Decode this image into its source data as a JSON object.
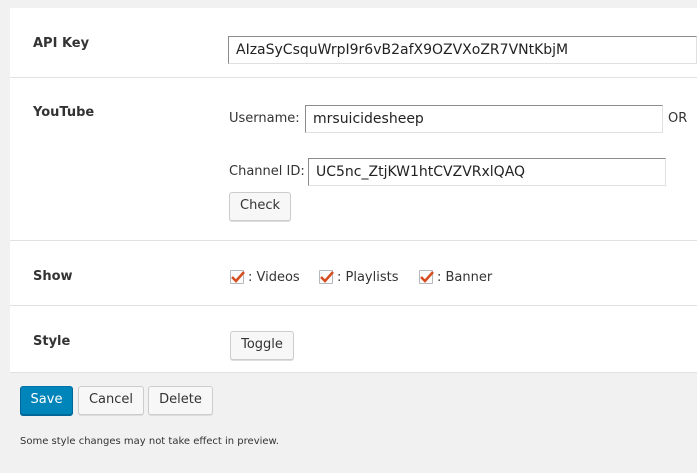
{
  "api_key": {
    "label": "API Key",
    "value": "AIzaSyCsquWrpI9r6vB2afX9OZVXoZR7VNtKbjM"
  },
  "youtube": {
    "label": "YouTube",
    "username_label": "Username:",
    "username_value": "mrsuicidesheep",
    "or_text": "OR",
    "channel_label": "Channel ID:",
    "channel_value": "UC5nc_ZtjKW1htCVZVRxlQAQ",
    "check_label": "Check"
  },
  "show": {
    "label": "Show",
    "options": [
      {
        "label": ": Videos",
        "checked": true
      },
      {
        "label": ": Playlists",
        "checked": true
      },
      {
        "label": ": Banner",
        "checked": true
      }
    ],
    "check_color": "#d54e21"
  },
  "style": {
    "label": "Style",
    "toggle_label": "Toggle"
  },
  "actions": {
    "save_label": "Save",
    "cancel_label": "Cancel",
    "delete_label": "Delete",
    "primary_color": "#0085ba"
  },
  "note": "Some style changes may not take effect in preview."
}
